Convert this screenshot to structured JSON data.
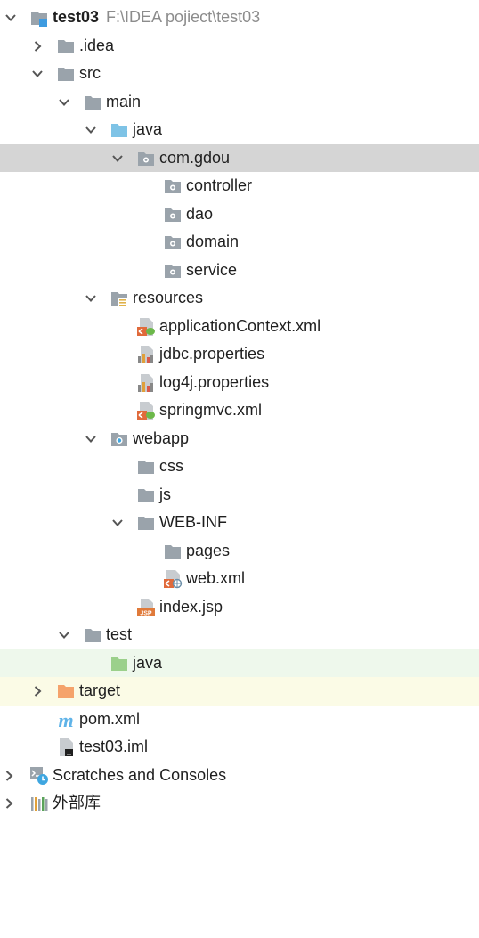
{
  "tree": {
    "root_label": "test03",
    "root_path": "F:\\IDEA pojiect\\test03",
    "items": {
      "idea": ".idea",
      "src": "src",
      "main": "main",
      "java": "java",
      "package": "com.gdou",
      "controller": "controller",
      "dao": "dao",
      "domain": "domain",
      "service": "service",
      "resources": "resources",
      "applicationContext": "applicationContext.xml",
      "jdbc": "jdbc.properties",
      "log4j": "log4j.properties",
      "springmvc": "springmvc.xml",
      "webapp": "webapp",
      "css": "css",
      "js": "js",
      "webinf": "WEB-INF",
      "pages": "pages",
      "webxml": "web.xml",
      "indexjsp": "index.jsp",
      "test": "test",
      "test_java": "java",
      "target": "target",
      "pom": "pom.xml",
      "iml": "test03.iml",
      "scratches": "Scratches and Consoles",
      "external_libs": "外部库"
    }
  },
  "colors": {
    "selected_row": "#d5d5d5",
    "test_row": "#eef8ec",
    "target_row": "#fbfbe6",
    "folder_gray": "#9aa3ab",
    "folder_blue": "#7ec3e6",
    "folder_green": "#9bd08b",
    "folder_orange": "#f5a36b",
    "maven_blue": "#5fb3e8"
  },
  "icons": {
    "module": "module-icon",
    "folder": "folder-icon",
    "source_folder": "source-folder-icon",
    "package": "package-icon",
    "resources": "resources-folder-icon",
    "spring_xml": "spring-xml-icon",
    "properties": "properties-icon",
    "web_folder": "web-folder-icon",
    "web_xml": "web-xml-icon",
    "jsp": "jsp-icon",
    "test_folder": "test-folder-icon",
    "excluded_folder": "excluded-folder-icon",
    "maven": "maven-icon",
    "iml": "iml-file-icon",
    "scratches": "scratches-icon",
    "libraries": "libraries-icon"
  }
}
